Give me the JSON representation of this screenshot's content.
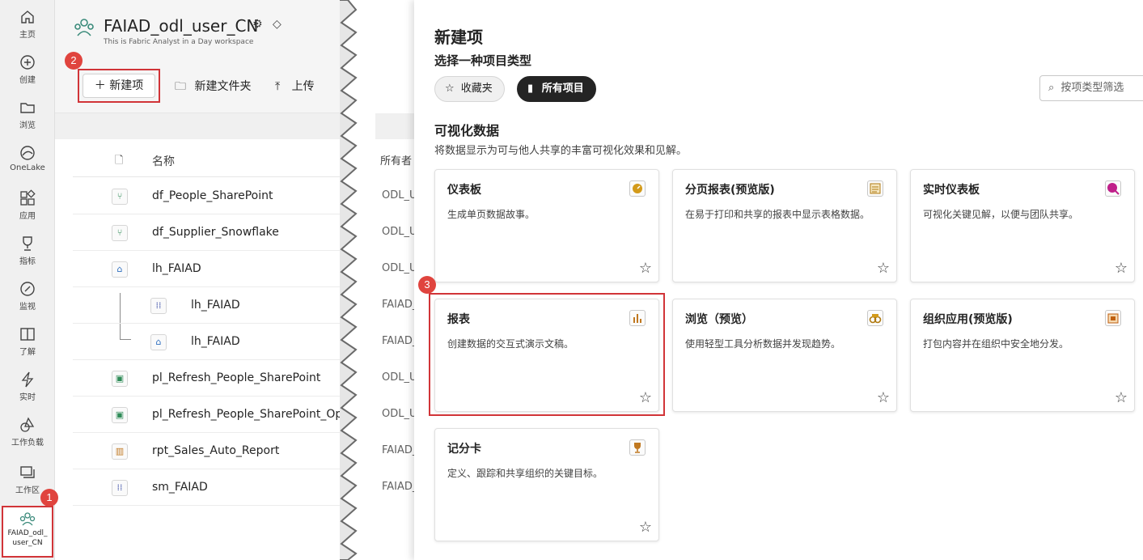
{
  "rail": {
    "items": [
      {
        "label": "主页",
        "icon": "home-icon"
      },
      {
        "label": "创建",
        "icon": "create-icon"
      },
      {
        "label": "浏览",
        "icon": "browse-icon"
      },
      {
        "label": "OneLake",
        "icon": "onelake-icon"
      },
      {
        "label": "应用",
        "icon": "apps-icon"
      },
      {
        "label": "指标",
        "icon": "metrics-icon"
      },
      {
        "label": "监视",
        "icon": "monitor-icon"
      },
      {
        "label": "了解",
        "icon": "learn-icon"
      },
      {
        "label": "实时",
        "icon": "realtime-icon"
      },
      {
        "label": "工作负载",
        "icon": "workloads-icon"
      },
      {
        "label": "工作区",
        "icon": "workspaces-icon"
      }
    ],
    "workspace_line1": "FAIAD_odl_",
    "workspace_line2": "user_CN"
  },
  "workspace": {
    "title": "FAIAD_odl_user_CN",
    "subtitle": "This is Fabric Analyst in a Day workspace",
    "toolbar": {
      "new_item": "新建项",
      "new_folder": "新建文件夹",
      "upload": "上传"
    },
    "list_header": "名称",
    "owner_header": "所有者",
    "rows": [
      {
        "name": "df_People_SharePoint",
        "icon": "dataflow-icon",
        "owner": "ODL_U"
      },
      {
        "name": "df_Supplier_Snowflake",
        "icon": "dataflow-icon",
        "owner": "ODL_U"
      },
      {
        "name": "lh_FAIAD",
        "icon": "lakehouse-icon",
        "owner": "ODL_U"
      },
      {
        "name": "lh_FAIAD",
        "icon": "semantic-model-icon",
        "owner": "FAIAD_"
      },
      {
        "name": "lh_FAIAD",
        "icon": "sql-endpoint-icon",
        "owner": "FAIAD_"
      },
      {
        "name": "pl_Refresh_People_SharePoint",
        "icon": "pipeline-icon",
        "owner": "ODL_U"
      },
      {
        "name": "pl_Refresh_People_SharePoint_Option",
        "icon": "pipeline-icon",
        "owner": "ODL_U"
      },
      {
        "name": "rpt_Sales_Auto_Report",
        "icon": "report-icon",
        "owner": "FAIAD_"
      },
      {
        "name": "sm_FAIAD",
        "icon": "semantic-model-icon",
        "owner": "FAIAD_"
      }
    ]
  },
  "panel": {
    "title": "新建项",
    "subtitle": "选择一种项目类型",
    "favorites": "收藏夹",
    "all_items": "所有项目",
    "filter_placeholder": "按项类型筛选",
    "section_title": "可视化数据",
    "section_desc": "将数据显示为可与他人共享的丰富可视化效果和见解。",
    "cards": [
      {
        "title": "仪表板",
        "desc": "生成单页数据故事。",
        "icon": "dashboard-icon"
      },
      {
        "title": "分页报表(预览版)",
        "desc": "在易于打印和共享的报表中显示表格数据。",
        "icon": "paginated-report-icon"
      },
      {
        "title": "实时仪表板",
        "desc": "可视化关键见解，以便与团队共享。",
        "icon": "realtime-dashboard-icon"
      },
      {
        "title": "报表",
        "desc": "创建数据的交互式演示文稿。",
        "icon": "report-icon"
      },
      {
        "title": "浏览（预览）",
        "desc": "使用轻型工具分析数据并发现趋势。",
        "icon": "explore-icon"
      },
      {
        "title": "组织应用(预览版)",
        "desc": "打包内容并在组织中安全地分发。",
        "icon": "org-app-icon"
      },
      {
        "title": "记分卡",
        "desc": "定义、跟踪和共享组织的关键目标。",
        "icon": "scorecard-icon"
      }
    ]
  },
  "badges": [
    "1",
    "2",
    "3"
  ],
  "colors": {
    "highlight": "#d13438",
    "badge": "#e0443e",
    "pill_active": "#242424"
  }
}
